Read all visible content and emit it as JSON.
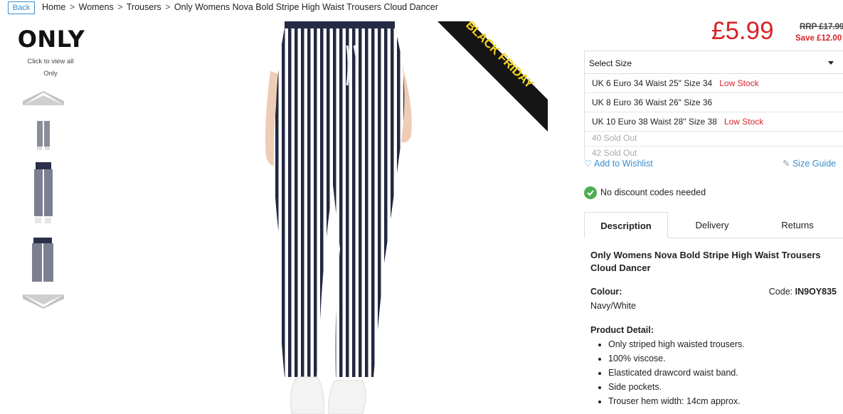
{
  "header": {
    "back_label": "Back",
    "breadcrumb": [
      "Home",
      "Womens",
      "Trousers",
      "Only Womens Nova Bold Stripe High Waist Trousers Cloud Dancer"
    ],
    "breadcrumb_sep": ">"
  },
  "brand": {
    "logo_text": "ONLY",
    "link_line1": "Click to view all",
    "link_line2": "Only"
  },
  "gallery": {
    "up_icon": "chevron-up-icon",
    "down_icon": "chevron-down-icon",
    "badge": "BLACK FRIDAY"
  },
  "price": {
    "current": "£5.99",
    "rrp": "RRP £17.99",
    "save": "Save £12.00"
  },
  "sizes": {
    "placeholder": "Select Size",
    "options": [
      {
        "label": "UK 6 Euro 34 Waist 25\" Size 34",
        "stock": "Low Stock"
      },
      {
        "label": "UK 8 Euro 36 Waist 26\" Size 36",
        "stock": ""
      },
      {
        "label": "UK 10 Euro 38 Waist 28\" Size 38",
        "stock": "Low Stock"
      },
      {
        "label": "40 Sold Out",
        "stock": ""
      },
      {
        "label": "42 Sold Out",
        "stock": ""
      }
    ]
  },
  "actions": {
    "wishlist": "Add to Wishlist",
    "size_guide": "Size Guide",
    "discount": "No discount codes needed"
  },
  "tabs": [
    "Description",
    "Delivery",
    "Returns"
  ],
  "description": {
    "title": "Only Womens Nova Bold Stripe High Waist Trousers Cloud Dancer",
    "colour_label": "Colour:",
    "colour_value": "Navy/White",
    "code_label": "Code:",
    "code_value": "IN9OY835",
    "detail_label": "Product Detail:",
    "details": [
      "Only striped high waisted trousers.",
      "100% viscose.",
      "Elasticated drawcord waist band.",
      "Side pockets.",
      "Trouser hem width: 14cm approx."
    ]
  },
  "colors": {
    "price_red": "#d8232a",
    "link_blue": "#3a8fd0",
    "badge_yellow": "#f4d21f",
    "success_green": "#4fae4f"
  }
}
